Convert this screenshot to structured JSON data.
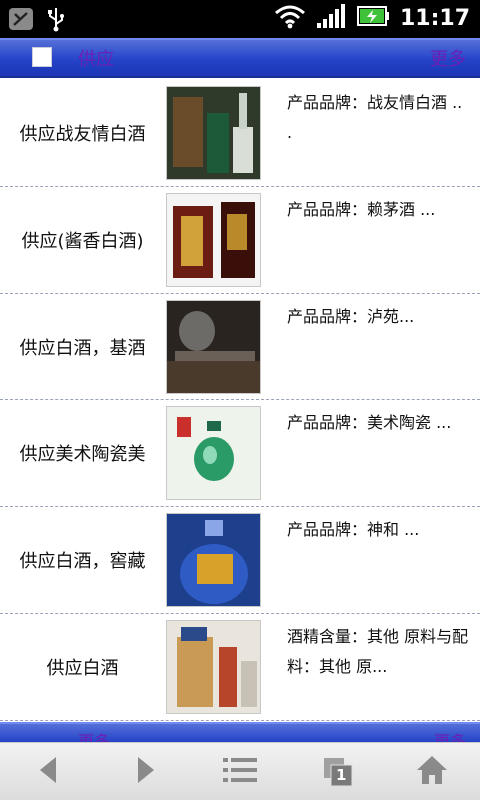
{
  "status_bar": {
    "time": "11:17",
    "icons": [
      "phone-sync-icon",
      "usb-icon",
      "wifi-icon",
      "signal-icon",
      "battery-charging-icon"
    ]
  },
  "header": {
    "title": "供应",
    "more": "更多"
  },
  "items": [
    {
      "name": "供应战友情白酒",
      "desc": "产品品牌：战友情白酒 ..\n.",
      "thumb_color": "#3a4c2c"
    },
    {
      "name": "供应(酱香白酒)",
      "desc": "产品品牌：赖茅酒 ...",
      "thumb_color": "#6b1d14"
    },
    {
      "name": "供应白酒，基酒",
      "desc": "产品品牌：泸苑...",
      "thumb_color": "#3c342c"
    },
    {
      "name": "供应美术陶瓷美",
      "desc": "产品品牌：美术陶瓷 ...",
      "thumb_color": "#e8efe6"
    },
    {
      "name": "供应白酒，窖藏",
      "desc": "产品品牌：神和 ...",
      "thumb_color": "#1d3f8c"
    },
    {
      "name": "供应白酒",
      "desc": "酒精含量：其他 原料与配料：其他 原...",
      "thumb_color": "#c99a55"
    }
  ],
  "footer": {
    "left": "更多",
    "right": "更多"
  },
  "toolbar": {
    "tabs_count": "1"
  }
}
